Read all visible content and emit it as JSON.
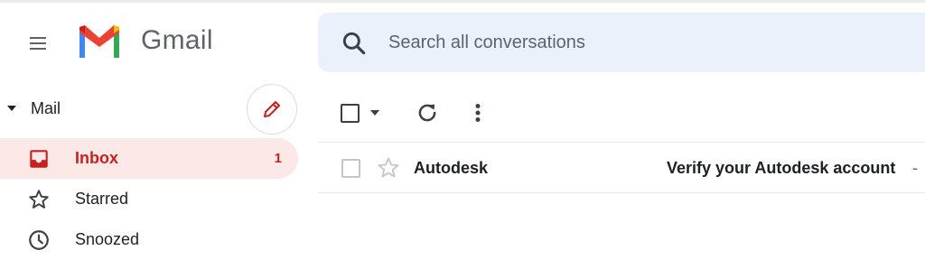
{
  "app": {
    "name": "Gmail",
    "brand_colors": {
      "red": "#ea4335",
      "blue": "#4285f4",
      "green": "#34a853",
      "yellow": "#fbbc04"
    }
  },
  "header": {
    "menu_icon": "hamburger-menu-icon",
    "search": {
      "placeholder": "Search all conversations",
      "value": "",
      "icon": "search-icon"
    }
  },
  "sidebar": {
    "section_label": "Mail",
    "compose_icon": "pencil-icon",
    "items": [
      {
        "label": "Inbox",
        "count": "1",
        "icon": "inbox-icon",
        "active": true
      },
      {
        "label": "Starred",
        "count": "",
        "icon": "star-icon",
        "active": false
      },
      {
        "label": "Snoozed",
        "count": "",
        "icon": "clock-icon",
        "active": false
      }
    ]
  },
  "toolbar": {
    "select_icon": "checkbox-icon",
    "select_menu_icon": "caret-down-icon",
    "refresh_icon": "refresh-icon",
    "more_icon": "more-vert-icon"
  },
  "emails": [
    {
      "sender": "Autodesk",
      "subject": "Verify your Autodesk account",
      "separator": "-",
      "unread": true,
      "starred": false
    }
  ],
  "colors": {
    "accent_red": "#c5221f",
    "active_bg": "#fce8e6",
    "search_bg": "#eaf1fb",
    "icon_gray": "#5f6368"
  }
}
